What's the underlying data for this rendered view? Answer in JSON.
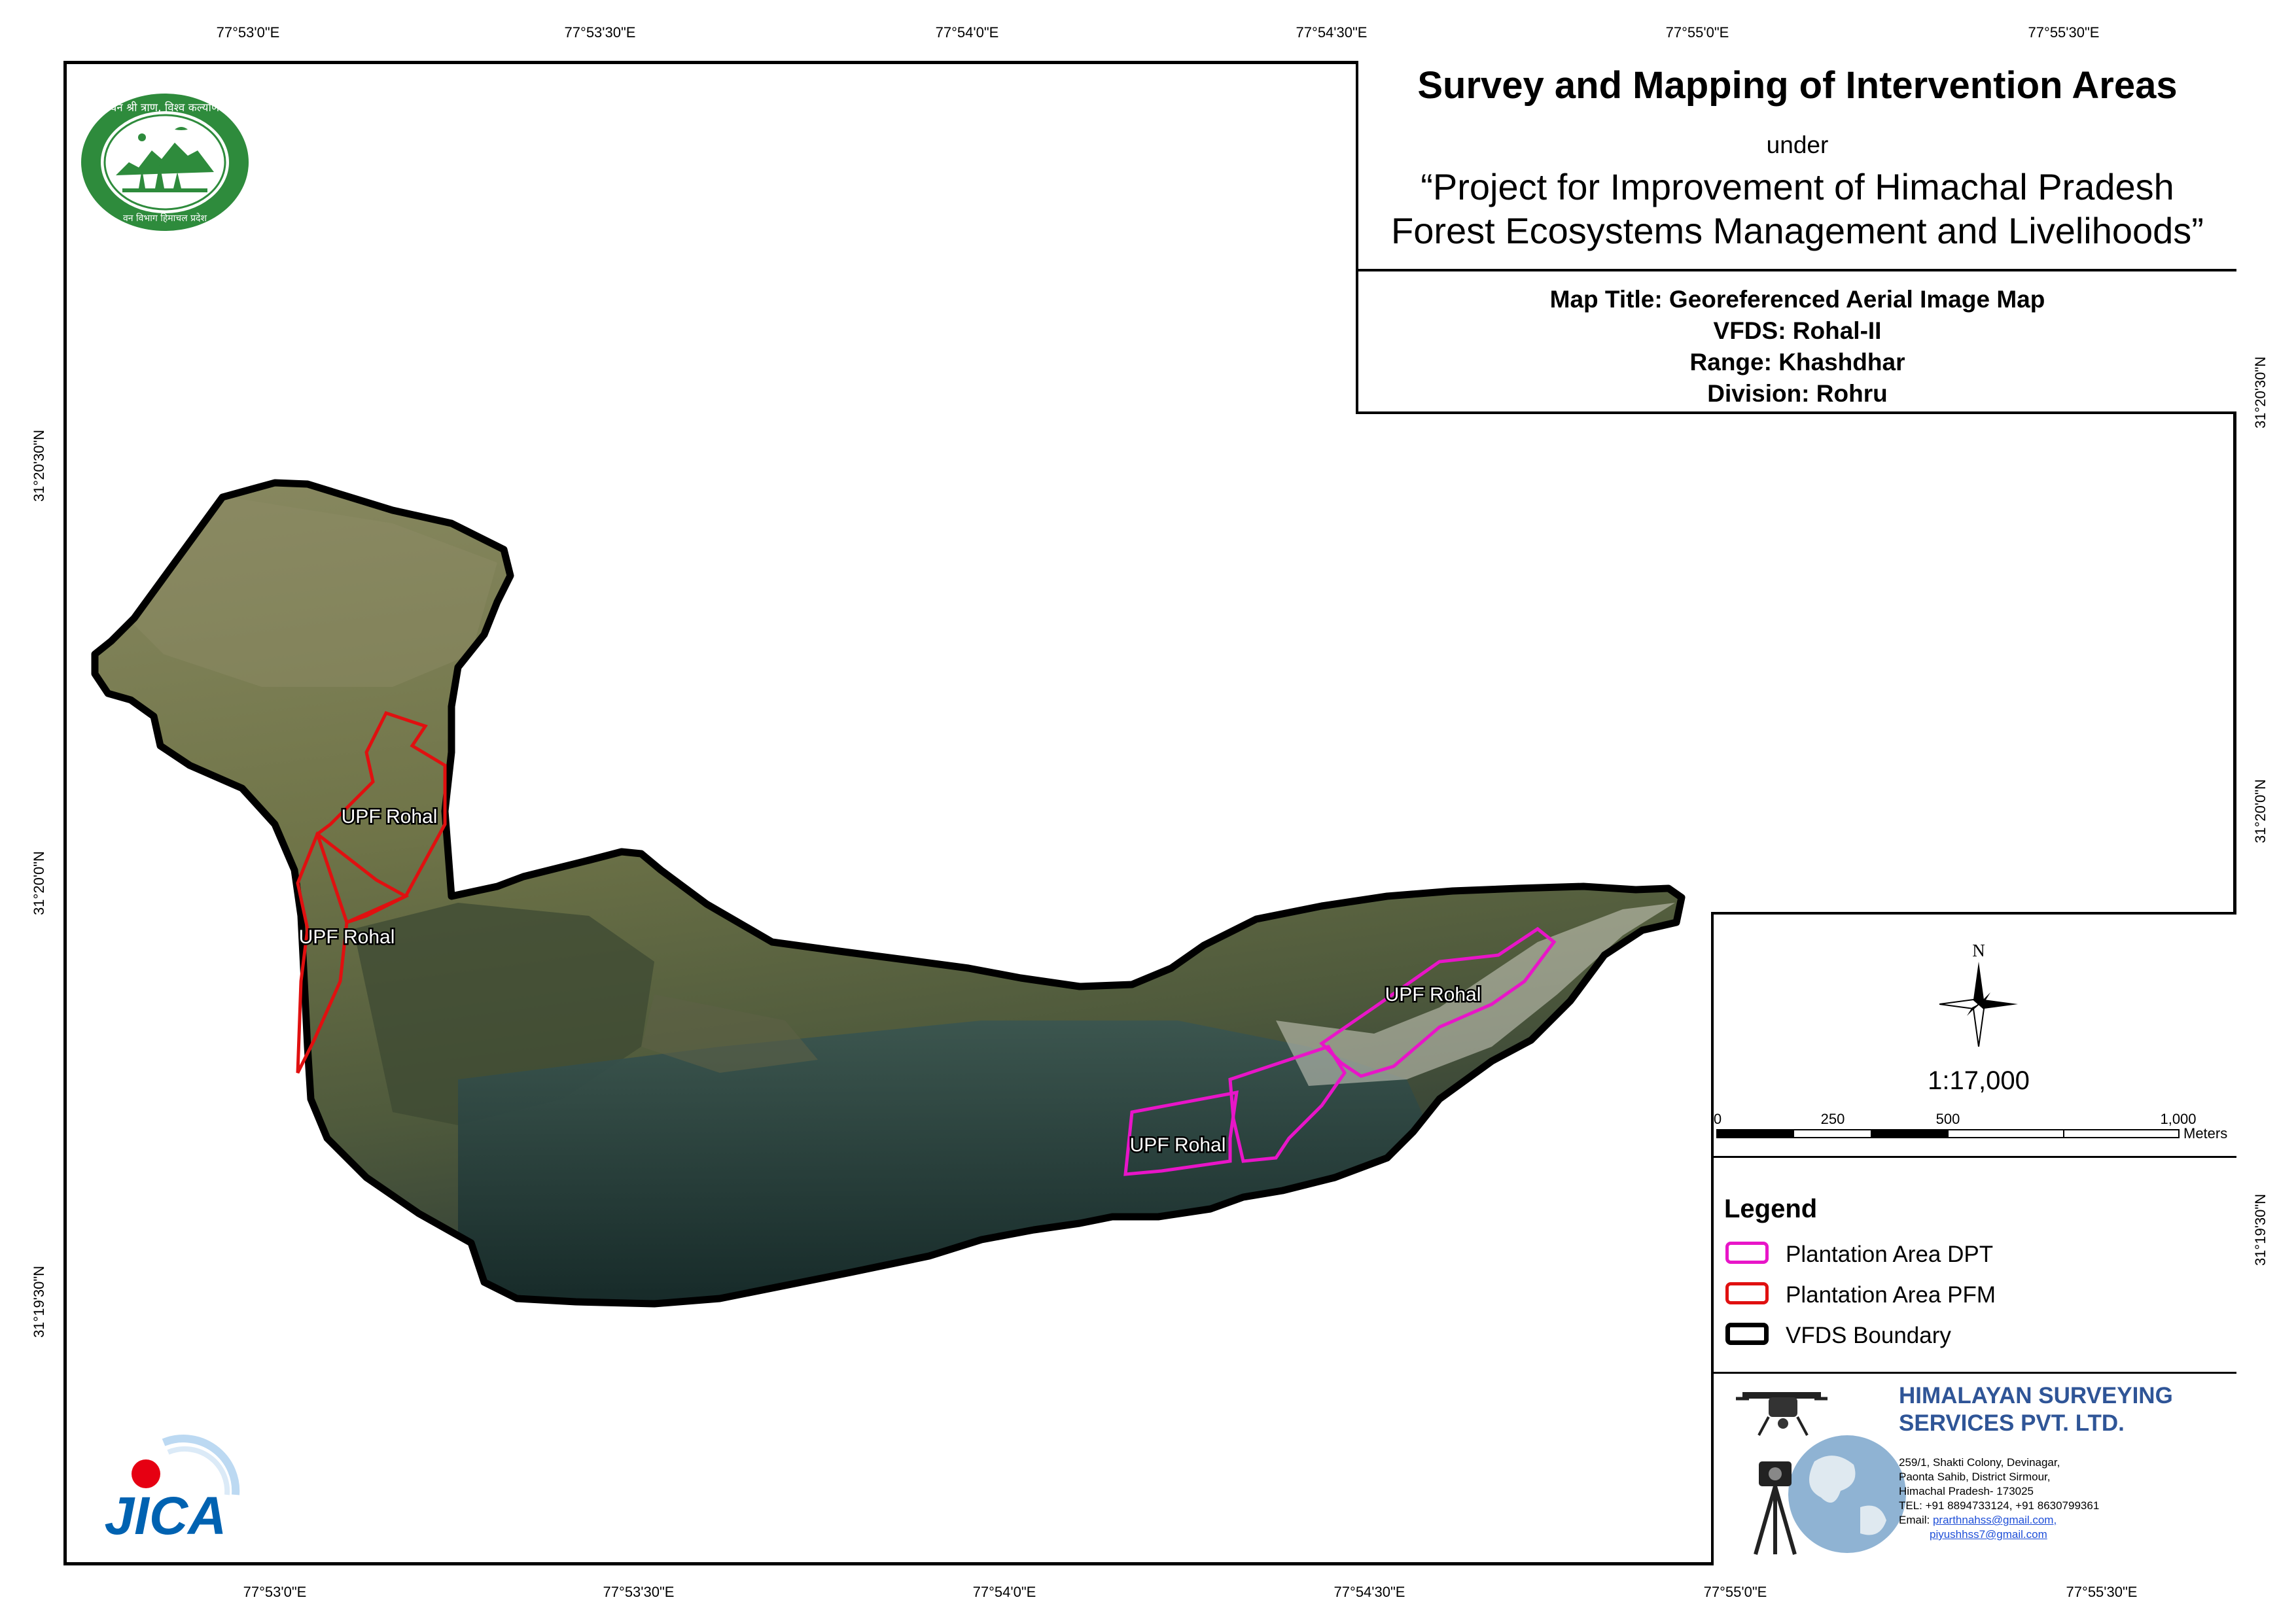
{
  "coordinates": {
    "top": [
      "77°53'0\"E",
      "77°53'30\"E",
      "77°54'0\"E",
      "77°54'30\"E",
      "77°55'0\"E",
      "77°55'30\"E"
    ],
    "bottom": [
      "77°53'0\"E",
      "77°53'30\"E",
      "77°54'0\"E",
      "77°54'30\"E",
      "77°55'0\"E",
      "77°55'30\"E"
    ],
    "left": [
      "31°20'30\"N",
      "31°20'0\"N",
      "31°19'30\"N"
    ],
    "right": [
      "31°20'30\"N",
      "31°20'0\"N",
      "31°19'30\"N"
    ]
  },
  "title": {
    "main": "Survey and Mapping of Intervention Areas",
    "under": "under",
    "project_line1": "“Project for Improvement of Himachal Pradesh",
    "project_line2": "Forest Ecosystems Management and Livelihoods”"
  },
  "map_info": {
    "map_title": "Map Title: Georeferenced Aerial Image Map",
    "vfds": "VFDS: Rohal-II",
    "range": "Range: Khashdhar",
    "division": "Division: Rohru"
  },
  "map": {
    "plantation_labels": [
      "UPF Rohal",
      "UPF Rohal",
      "UPF Rohal",
      "UPF Rohal"
    ]
  },
  "north_arrow": {
    "letter": "N"
  },
  "scale": {
    "ratio": "1:17,000",
    "ticks": [
      "0",
      "250",
      "500",
      "1,000"
    ],
    "unit": "Meters"
  },
  "legend": {
    "title": "Legend",
    "items": [
      {
        "label": "Plantation Area DPT",
        "color": "#e815c8"
      },
      {
        "label": "Plantation Area PFM",
        "color": "#e01010"
      },
      {
        "label": "VFDS Boundary",
        "color": "#000000"
      }
    ]
  },
  "company": {
    "name_line1": "HIMALAYAN SURVEYING",
    "name_line2": "SERVICES PVT. LTD.",
    "address1": "259/1, Shakti Colony, Devinagar,",
    "address2": "Paonta Sahib, District Sirmour,",
    "address3": "Himachal Pradesh- 173025",
    "tel": "TEL: +91 8894733124, +91 8630799361",
    "email_label": "Email: ",
    "email1": "prarthnahss@gmail.com,",
    "email2": "piyushhss7@gmail.com",
    "brand_color": "#2f5597"
  },
  "logos": {
    "forest_dept_upper": "वन श्री त्राण, विश्व कल्याण",
    "forest_dept_lower": "वन विभाग हिमाचल प्रदेश",
    "jica": "JICA"
  }
}
